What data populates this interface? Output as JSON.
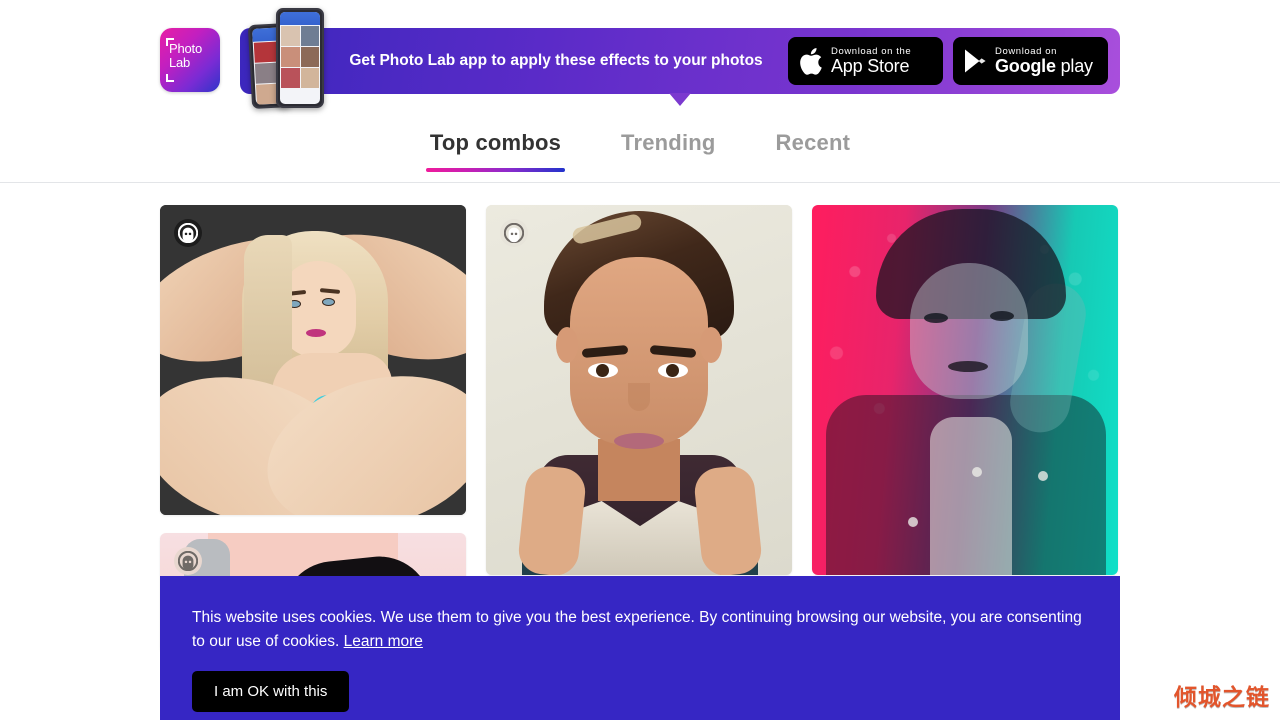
{
  "promo": {
    "logo": {
      "line1": "Photo",
      "line2": "Lab",
      "name": "photo-lab-logo"
    },
    "headline": "Get Photo Lab app to apply these effects to your photos",
    "stores": [
      {
        "small": "Download on the",
        "big": "App Store",
        "icon": "apple-icon"
      },
      {
        "small": "Download on",
        "big_strong": "Google",
        "big_light": " play",
        "icon": "google-play-icon"
      }
    ]
  },
  "tabs": [
    {
      "label": "Top combos",
      "active": true
    },
    {
      "label": "Trending",
      "active": false
    },
    {
      "label": "Recent",
      "active": false
    }
  ],
  "cards": [
    {
      "id": "card-1",
      "badge": "face-badge-icon",
      "alt": "Cartoon illustration of blonde woman making heart with hands on dark background"
    },
    {
      "id": "card-2",
      "badge": "face-badge-icon",
      "alt": "Cartoon portrait of dark haired man pulling hood collar on beige background"
    },
    {
      "id": "card-3",
      "badge": "face-badge-icon",
      "alt": "Duotone pink and teal photo of young man with styled hair"
    },
    {
      "id": "card-4",
      "badge": "face-badge-icon",
      "alt": "Partially visible cartoon portrait"
    }
  ],
  "cookie": {
    "text": "This website uses cookies. We use them to give you the best experience. By continuing browsing our website, you are consenting to our use of cookies. ",
    "learn_more": "Learn more",
    "accept_label": "I am OK with this"
  },
  "watermark": {
    "text": "倾城之链"
  },
  "colors": {
    "banner_start": "#3b27bd",
    "banner_end": "#a94fdc",
    "cookie_bg": "#3626c4",
    "tab_active": "#333333",
    "tab_inactive": "#9b9b9b",
    "underline_start": "#ef1b9b",
    "underline_end": "#2233cc",
    "watermark": "#e2552c"
  }
}
